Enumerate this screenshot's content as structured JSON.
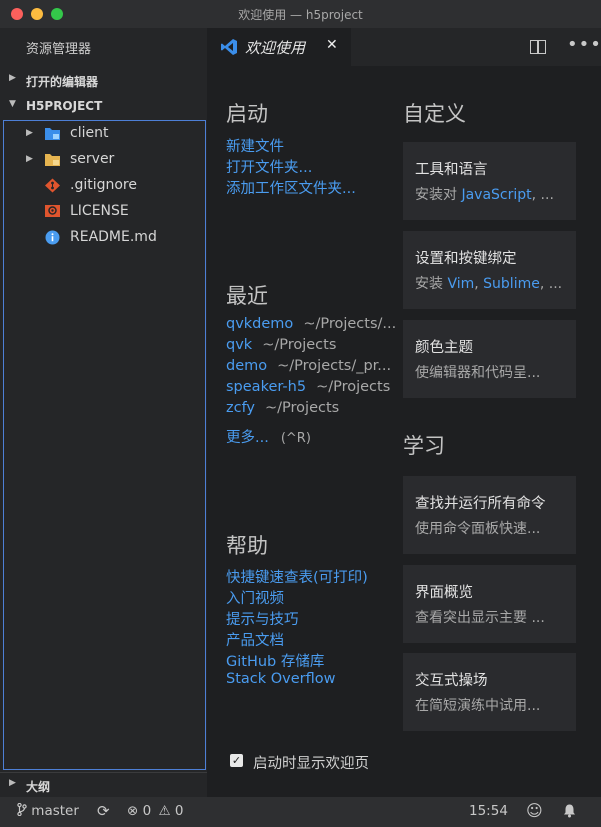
{
  "window": {
    "title": "欢迎使用 — h5project"
  },
  "sidebar": {
    "title": "资源管理器",
    "open_editors": "打开的编辑器",
    "project": "H5PROJECT",
    "outline": "大纲",
    "files": [
      {
        "name": "client",
        "type": "folder",
        "icon": "folder-blue-icon"
      },
      {
        "name": "server",
        "type": "folder",
        "icon": "folder-yellow-icon"
      },
      {
        "name": ".gitignore",
        "type": "file",
        "icon": "git-icon"
      },
      {
        "name": "LICENSE",
        "type": "file",
        "icon": "license-icon"
      },
      {
        "name": "README.md",
        "type": "file",
        "icon": "info-icon"
      }
    ]
  },
  "tab": {
    "label": "欢迎使用",
    "close": "✕"
  },
  "welcome": {
    "start": {
      "heading": "启动",
      "links": [
        "新建文件",
        "打开文件夹...",
        "添加工作区文件夹..."
      ]
    },
    "recent": {
      "heading": "最近",
      "items": [
        {
          "name": "qvkdemo",
          "path": "~/Projects/..."
        },
        {
          "name": "qvk",
          "path": "~/Projects"
        },
        {
          "name": "demo",
          "path": "~/Projects/_pr..."
        },
        {
          "name": "speaker-h5",
          "path": "~/Projects"
        },
        {
          "name": "zcfy",
          "path": "~/Projects"
        }
      ],
      "more": "更多...",
      "more_shortcut": "(^R)"
    },
    "help": {
      "heading": "帮助",
      "links": [
        "快捷键速查表(可打印)",
        "入门视频",
        "提示与技巧",
        "产品文档",
        "GitHub 存储库",
        "Stack Overflow"
      ]
    },
    "customize": {
      "heading": "自定义",
      "cards": [
        {
          "title": "工具和语言",
          "desc_prefix": "安装对 ",
          "desc_highlight": "JavaScript",
          "desc_suffix": ", ..."
        },
        {
          "title": "设置和按键绑定",
          "desc_prefix": "安装 ",
          "desc_highlight": "Vim",
          "desc_mid": ", ",
          "desc_highlight2": "Sublime",
          "desc_suffix": ", ..."
        },
        {
          "title": "颜色主题",
          "desc": "使编辑器和代码呈..."
        }
      ]
    },
    "learn": {
      "heading": "学习",
      "cards": [
        {
          "title": "查找并运行所有命令",
          "desc": "使用命令面板快速..."
        },
        {
          "title": "界面概览",
          "desc": "查看突出显示主要 ..."
        },
        {
          "title": "交互式操场",
          "desc": "在简短演练中试用..."
        }
      ]
    },
    "show_on_startup": {
      "label": "启动时显示欢迎页",
      "checked": true
    }
  },
  "statusbar": {
    "branch": "master",
    "errors": "0",
    "warnings": "0",
    "time": "15:54"
  },
  "colors": {
    "accent": "#4a9cf0",
    "background": "#1e1f21",
    "sidebar": "#252628"
  }
}
